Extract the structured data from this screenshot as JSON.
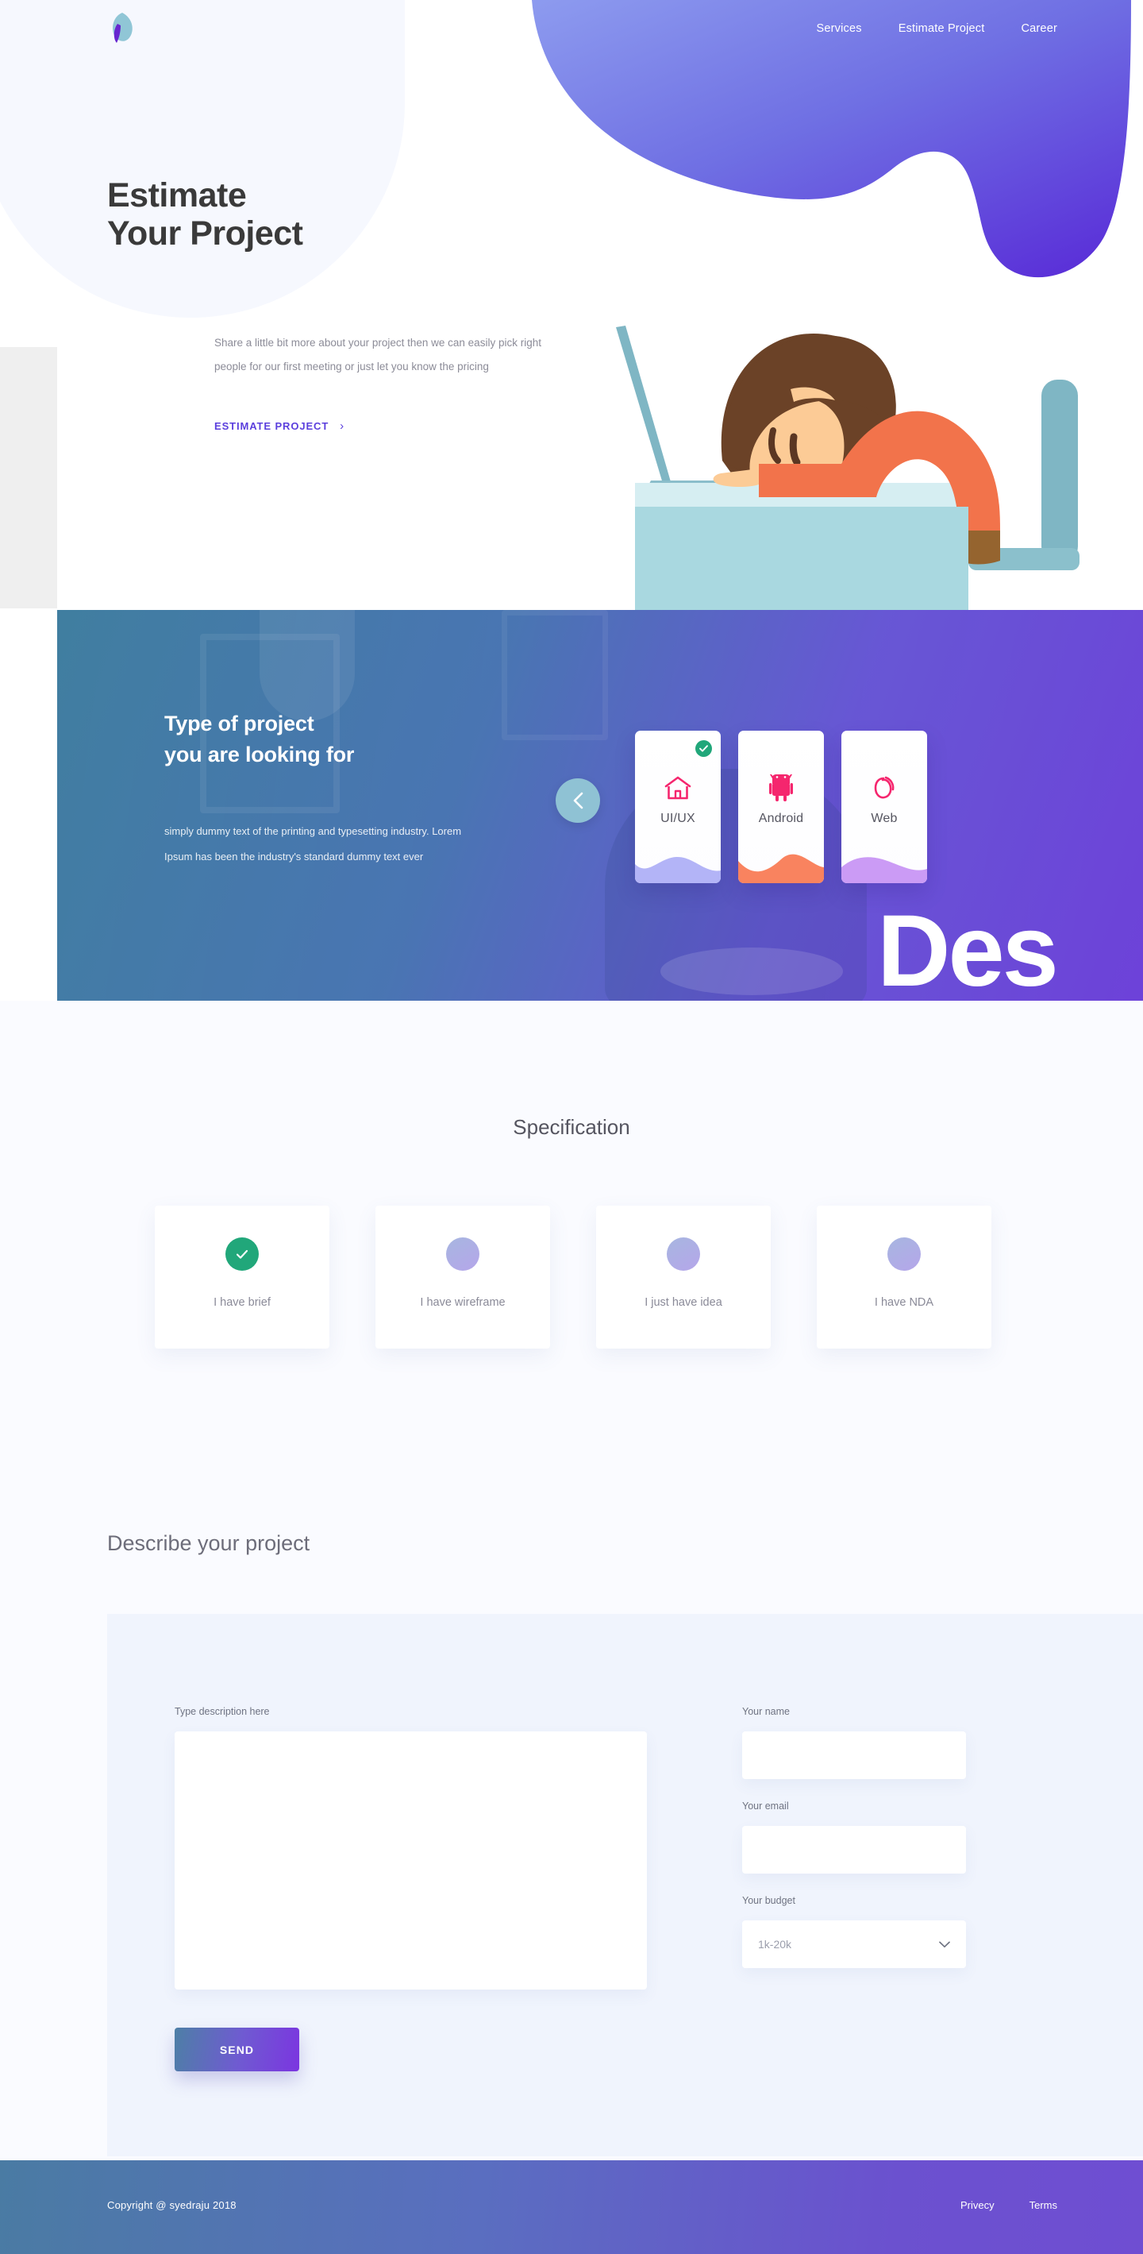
{
  "brand": {
    "logo_icon": "leaf-logo-icon"
  },
  "nav": {
    "items": [
      {
        "label": "Services"
      },
      {
        "label": "Estimate Project"
      },
      {
        "label": "Career"
      }
    ]
  },
  "hero": {
    "title_line1": "Estimate",
    "title_line2": "Your Project",
    "description": "Share a little bit more about your project then we can easily pick right people for our first meeting or just let you know the pricing",
    "cta_label": "ESTIMATE PROJECT",
    "cta_chevron": "›",
    "illustration": "woman-sleeping-at-desk-illustration",
    "accent_purple": "#5b3fdd"
  },
  "project_type": {
    "title_line1": "Type of project",
    "title_line2": "you are looking for",
    "description": "simply dummy text of the printing and typesetting industry. Lorem Ipsum has been the industry's standard dummy text ever",
    "prev_button_icon": "chevron-left-icon",
    "big_word": "Des",
    "cards": [
      {
        "label": "UI/UX",
        "icon": "home-icon",
        "icon_color": "#f5266e",
        "wave_color": "#b3b4f7",
        "selected": true
      },
      {
        "label": "Android",
        "icon": "android-icon",
        "icon_color": "#f5266e",
        "wave_color": "#f9835f",
        "selected": false
      },
      {
        "label": "Web",
        "icon": "link-icon",
        "icon_color": "#f5266e",
        "wave_color": "#cb9bf5",
        "selected": false
      }
    ]
  },
  "specification": {
    "title": "Specification",
    "cards": [
      {
        "label": "I have brief",
        "selected": true
      },
      {
        "label": "I have wireframe",
        "selected": false
      },
      {
        "label": "I just have idea",
        "selected": false
      },
      {
        "label": "I have NDA",
        "selected": false
      }
    ]
  },
  "describe": {
    "title": "Describe your project",
    "description_label": "Type description here",
    "description_value": "",
    "description_placeholder": "",
    "name_label": "Your name",
    "name_value": "",
    "email_label": "Your email",
    "email_value": "",
    "budget_label": "Your budget",
    "budget_value": "1k-20k",
    "budget_options": [
      "1k-20k"
    ],
    "budget_chevron_icon": "chevron-down-icon",
    "send_label": "SEND"
  },
  "footer": {
    "copyright": "Copyright @ syedraju 2018",
    "links": [
      {
        "label": "Privecy"
      },
      {
        "label": "Terms"
      }
    ]
  }
}
